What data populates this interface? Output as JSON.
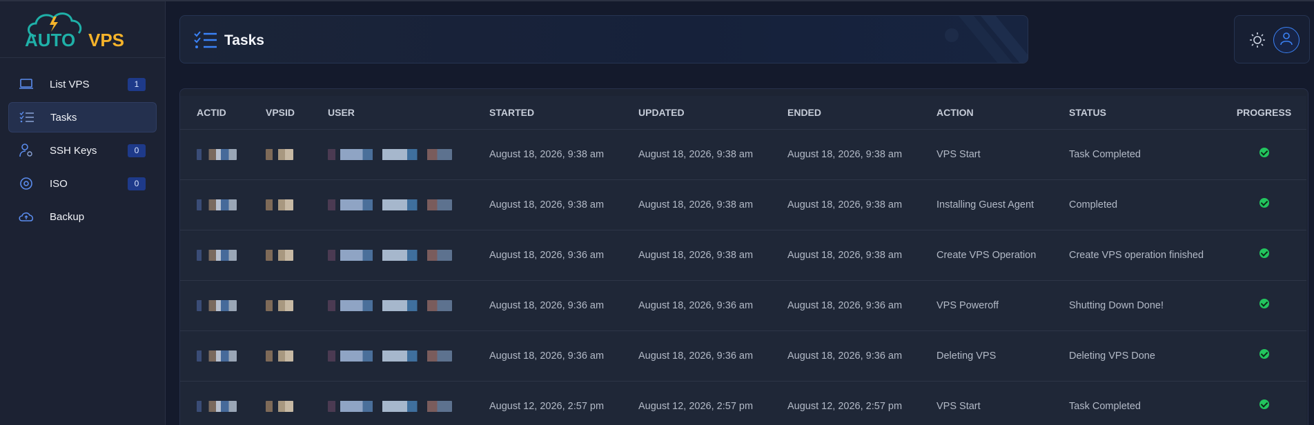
{
  "brand": {
    "name_part1": "AUTO",
    "name_part2": "VPS",
    "accent": "#f5b32a",
    "teal": "#1fb0a8"
  },
  "sidebar": {
    "items": [
      {
        "label": "List VPS",
        "icon": "laptop-icon",
        "badge": "1"
      },
      {
        "label": "Tasks",
        "icon": "tasks-list-icon",
        "active": true
      },
      {
        "label": "SSH Keys",
        "icon": "user-key-icon",
        "badge": "0"
      },
      {
        "label": "ISO",
        "icon": "disc-icon",
        "badge": "0"
      },
      {
        "label": "Backup",
        "icon": "cloud-upload-icon"
      }
    ]
  },
  "header": {
    "title": "Tasks",
    "icon": "tasks-list-icon"
  },
  "topbar": {
    "theme_icon": "sun-icon",
    "avatar_icon": "user-icon"
  },
  "table": {
    "columns": [
      "ACTID",
      "VPSID",
      "USER",
      "STARTED",
      "UPDATED",
      "ENDED",
      "ACTION",
      "STATUS",
      "PROGRESS"
    ],
    "rows": [
      {
        "started": "August 18, 2026, 9:38 am",
        "updated": "August 18, 2026, 9:38 am",
        "ended": "August 18, 2026, 9:38 am",
        "action": "VPS Start",
        "status": "Task Completed"
      },
      {
        "started": "August 18, 2026, 9:38 am",
        "updated": "August 18, 2026, 9:38 am",
        "ended": "August 18, 2026, 9:38 am",
        "action": "Installing Guest Agent",
        "status": "Completed"
      },
      {
        "started": "August 18, 2026, 9:36 am",
        "updated": "August 18, 2026, 9:38 am",
        "ended": "August 18, 2026, 9:38 am",
        "action": "Create VPS Operation",
        "status": "Create VPS operation finished"
      },
      {
        "started": "August 18, 2026, 9:36 am",
        "updated": "August 18, 2026, 9:36 am",
        "ended": "August 18, 2026, 9:36 am",
        "action": "VPS Poweroff",
        "status": "Shutting Down Done!"
      },
      {
        "started": "August 18, 2026, 9:36 am",
        "updated": "August 18, 2026, 9:36 am",
        "ended": "August 18, 2026, 9:36 am",
        "action": "Deleting VPS",
        "status": "Deleting VPS Done"
      },
      {
        "started": "August 12, 2026, 2:57 pm",
        "updated": "August 12, 2026, 2:57 pm",
        "ended": "August 12, 2026, 2:57 pm",
        "action": "VPS Start",
        "status": "Task Completed"
      }
    ]
  },
  "colors": {
    "primary": "#3b82f6",
    "success": "#22c55e",
    "badge_bg": "#1e3a8a"
  }
}
